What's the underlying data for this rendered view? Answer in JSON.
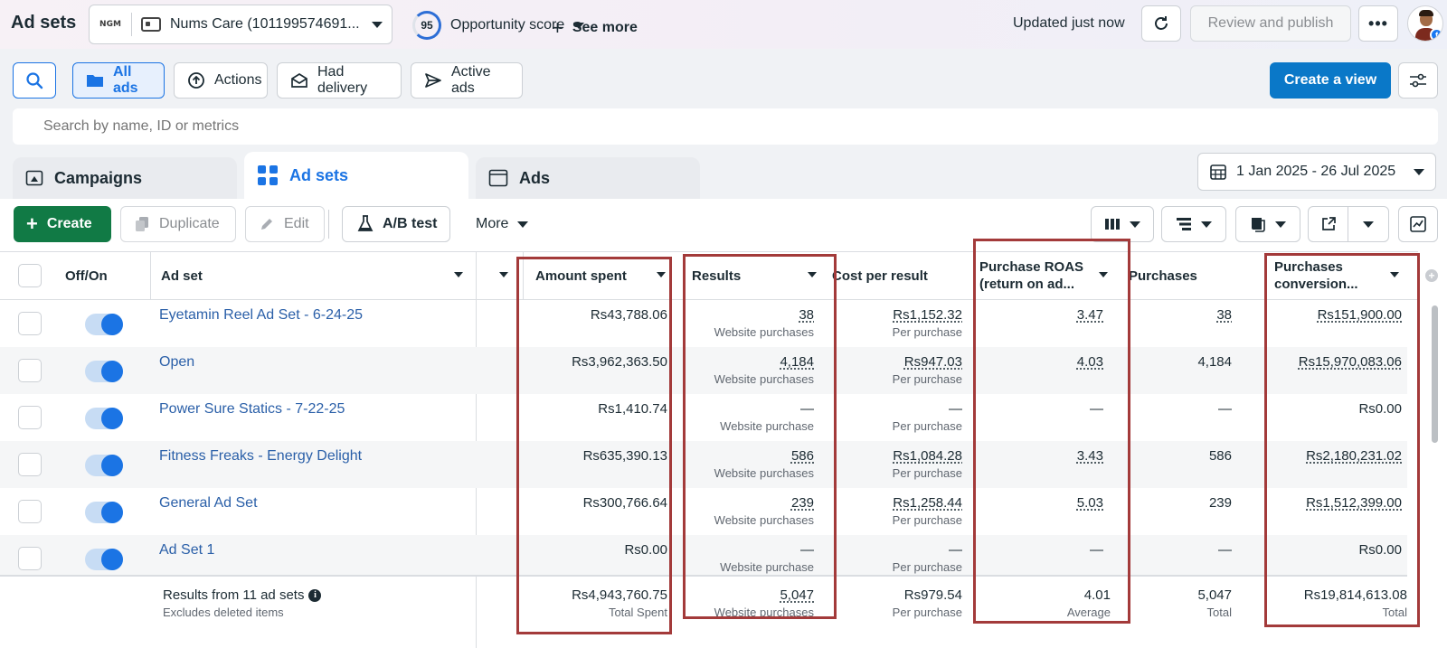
{
  "header": {
    "title": "Ad sets",
    "account_logo_text": "NGM",
    "account_name": "Nums Care (101199574691...",
    "opportunity_score": "95",
    "opportunity_label": "Opportunity score",
    "updated_text": "Updated just now",
    "review_publish_label": "Review and publish",
    "more_label": "•••"
  },
  "filters": {
    "all_ads": "All ads",
    "actions": "Actions",
    "had_delivery": "Had delivery",
    "active_ads": "Active ads",
    "see_more": "See more",
    "create_view": "Create a view"
  },
  "search": {
    "placeholder": "Search by name, ID or metrics"
  },
  "tabs": [
    {
      "label": "Campaigns",
      "icon": "campaign-folder-icon"
    },
    {
      "label": "Ad sets",
      "icon": "grid-icon",
      "active": true
    },
    {
      "label": "Ads",
      "icon": "ad-window-icon"
    }
  ],
  "date_range": "1 Jan 2025 - 26 Jul 2025",
  "toolbar": {
    "create": "Create",
    "duplicate": "Duplicate",
    "edit": "Edit",
    "ab_test": "A/B test",
    "more": "More"
  },
  "columns": {
    "off_on": "Off/On",
    "ad_set": "Ad set",
    "amount_spent": "Amount spent",
    "results": "Results",
    "cost_per_result": "Cost per result",
    "roas_line1": "Purchase ROAS",
    "roas_line2": "(return on ad...",
    "purchases": "Purchases",
    "conv_line1": "Purchases",
    "conv_line2": "conversion..."
  },
  "rows": [
    {
      "name": "Eyetamin Reel Ad Set - 6-24-25",
      "spent": "Rs43,788.06",
      "results": "38",
      "results_sub": "Website purchases",
      "cpr": "Rs1,152.32",
      "cpr_sub": "Per purchase",
      "roas": "3.47",
      "purchases": "38",
      "conv": "Rs151,900.00"
    },
    {
      "name": "Open",
      "spent": "Rs3,962,363.50",
      "results": "4,184",
      "results_sub": "Website purchases",
      "cpr": "Rs947.03",
      "cpr_sub": "Per purchase",
      "roas": "4.03",
      "purchases": "4,184",
      "conv": "Rs15,970,083.06"
    },
    {
      "name": "Power Sure Statics - 7-22-25",
      "spent": "Rs1,410.74",
      "results": "—",
      "results_sub": "Website purchase",
      "cpr": "—",
      "cpr_sub": "Per purchase",
      "roas": "—",
      "purchases": "—",
      "conv": "Rs0.00"
    },
    {
      "name": "Fitness Freaks - Energy Delight",
      "spent": "Rs635,390.13",
      "results": "586",
      "results_sub": "Website purchases",
      "cpr": "Rs1,084.28",
      "cpr_sub": "Per purchase",
      "roas": "3.43",
      "purchases": "586",
      "conv": "Rs2,180,231.02"
    },
    {
      "name": "General Ad Set",
      "spent": "Rs300,766.64",
      "results": "239",
      "results_sub": "Website purchases",
      "cpr": "Rs1,258.44",
      "cpr_sub": "Per purchase",
      "roas": "5.03",
      "purchases": "239",
      "conv": "Rs1,512,399.00"
    },
    {
      "name": "Ad Set 1",
      "spent": "Rs0.00",
      "results": "—",
      "results_sub": "Website purchase",
      "cpr": "—",
      "cpr_sub": "Per purchase",
      "roas": "—",
      "purchases": "—",
      "conv": "Rs0.00"
    }
  ],
  "totals": {
    "title": "Results from 11 ad sets",
    "info_glyph": "i",
    "subtitle": "Excludes deleted items",
    "spent": "Rs4,943,760.75",
    "spent_sub": "Total Spent",
    "results": "5,047",
    "results_sub": "Website purchases",
    "cpr": "Rs979.54",
    "cpr_sub": "Per purchase",
    "roas": "4.01",
    "roas_sub": "Average",
    "purchases": "5,047",
    "purchases_sub": "Total",
    "conv": "Rs19,814,613.08",
    "conv_sub": "Total"
  },
  "colors": {
    "primary_blue": "#0a78c8",
    "create_green": "#117a45",
    "link_blue": "#2a5fa8",
    "highlight_red": "#a33a3a"
  }
}
